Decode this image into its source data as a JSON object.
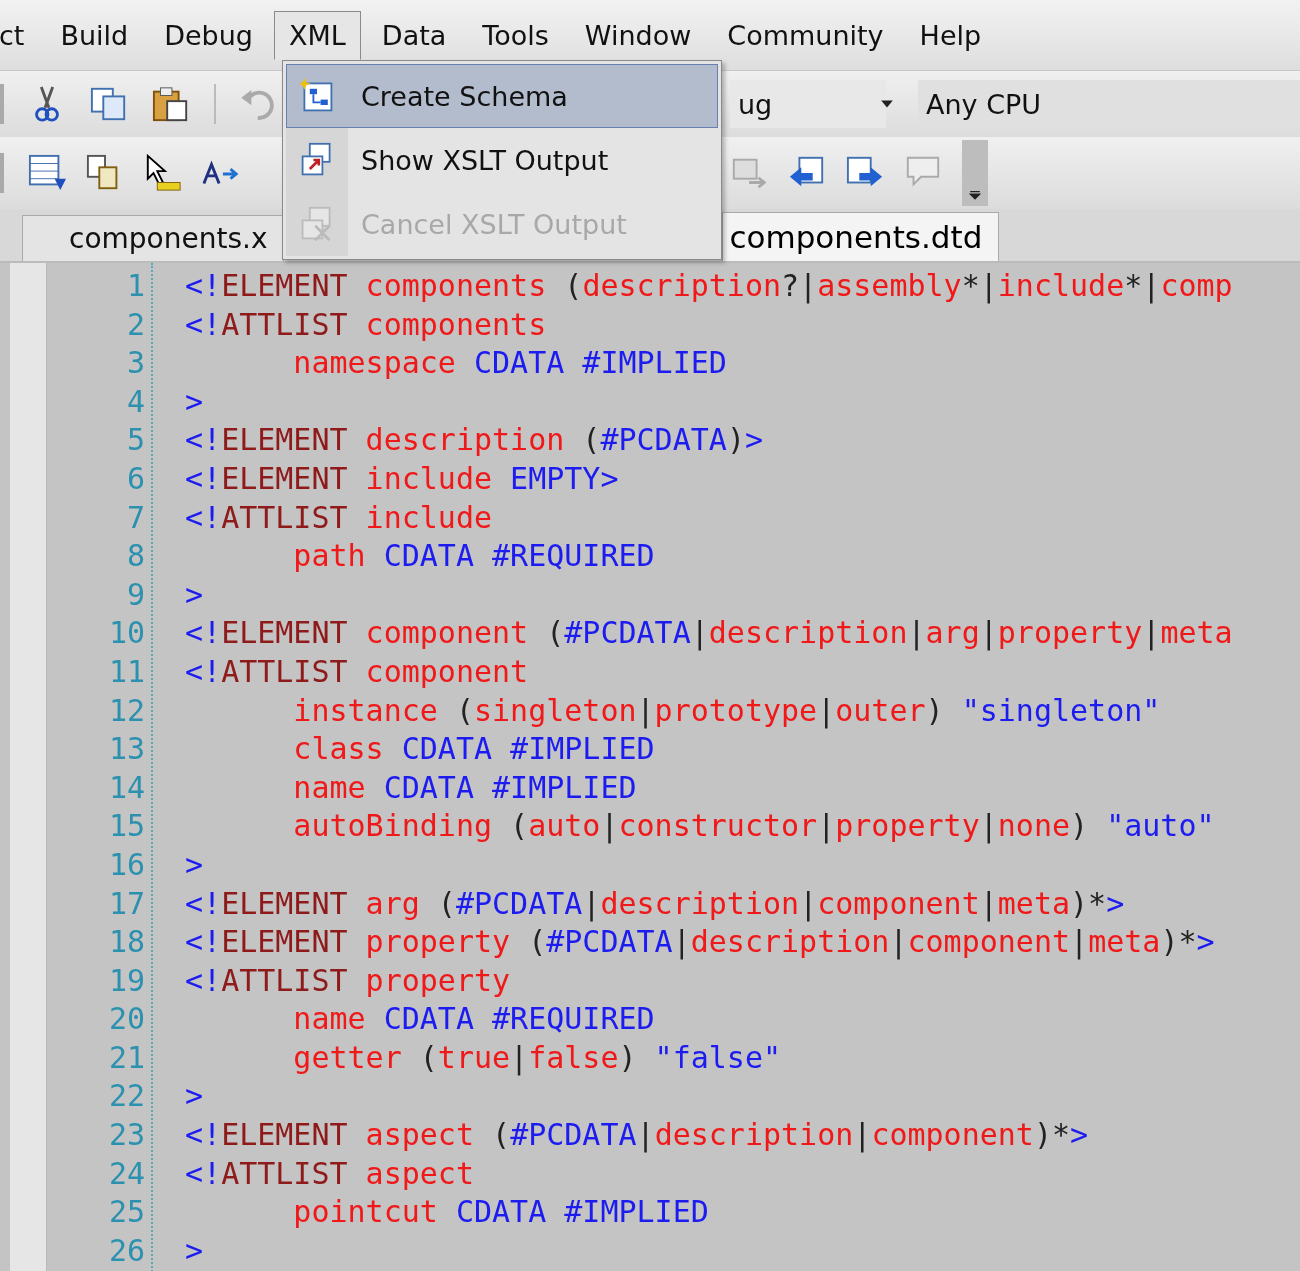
{
  "menu_bar": {
    "items": [
      {
        "label": "ct",
        "selected": false
      },
      {
        "label": "Build",
        "selected": false
      },
      {
        "label": "Debug",
        "selected": false
      },
      {
        "label": "XML",
        "selected": true
      },
      {
        "label": "Data",
        "selected": false
      },
      {
        "label": "Tools",
        "selected": false
      },
      {
        "label": "Window",
        "selected": false
      },
      {
        "label": "Community",
        "selected": false
      },
      {
        "label": "Help",
        "selected": false
      }
    ]
  },
  "toolbar": {
    "configuration": "ug",
    "platform": "Any CPU"
  },
  "tabs": [
    {
      "label": "components.x",
      "selected": false
    },
    {
      "label": "components.dtd",
      "selected": true
    }
  ],
  "xml_menu": {
    "items": [
      {
        "label": "Create Schema",
        "selected": true,
        "disabled": false
      },
      {
        "label": "Show XSLT Output",
        "selected": false,
        "disabled": false
      },
      {
        "label": "Cancel XSLT Output",
        "selected": false,
        "disabled": true
      }
    ]
  },
  "editor": {
    "lines": [
      {
        "number": "1",
        "indented": false,
        "tokens": [
          {
            "kind": "delim",
            "text": "<!"
          },
          {
            "kind": "keyword",
            "text": "ELEMENT"
          },
          {
            "kind": "name",
            "text": " components"
          },
          {
            "kind": "plain",
            "text": " ("
          },
          {
            "kind": "name",
            "text": "description"
          },
          {
            "kind": "plain",
            "text": "?|"
          },
          {
            "kind": "name",
            "text": "assembly"
          },
          {
            "kind": "plain",
            "text": "*|"
          },
          {
            "kind": "name",
            "text": "include"
          },
          {
            "kind": "plain",
            "text": "*|"
          },
          {
            "kind": "name",
            "text": "comp"
          }
        ]
      },
      {
        "number": "2",
        "indented": false,
        "tokens": [
          {
            "kind": "delim",
            "text": "<!"
          },
          {
            "kind": "keyword",
            "text": "ATTLIST"
          },
          {
            "kind": "name",
            "text": " components"
          }
        ]
      },
      {
        "number": "3",
        "indented": true,
        "tokens": [
          {
            "kind": "name",
            "text": "namespace"
          },
          {
            "kind": "value",
            "text": " CDATA #IMPLIED"
          }
        ]
      },
      {
        "number": "4",
        "indented": false,
        "tokens": [
          {
            "kind": "delim",
            "text": ">"
          }
        ]
      },
      {
        "number": "5",
        "indented": false,
        "tokens": [
          {
            "kind": "delim",
            "text": "<!"
          },
          {
            "kind": "keyword",
            "text": "ELEMENT"
          },
          {
            "kind": "name",
            "text": " description"
          },
          {
            "kind": "plain",
            "text": " ("
          },
          {
            "kind": "value",
            "text": "#PCDATA"
          },
          {
            "kind": "plain",
            "text": ")"
          },
          {
            "kind": "delim",
            "text": ">"
          }
        ]
      },
      {
        "number": "6",
        "indented": false,
        "tokens": [
          {
            "kind": "delim",
            "text": "<!"
          },
          {
            "kind": "keyword",
            "text": "ELEMENT"
          },
          {
            "kind": "name",
            "text": " include"
          },
          {
            "kind": "value",
            "text": " EMPTY"
          },
          {
            "kind": "delim",
            "text": ">"
          }
        ]
      },
      {
        "number": "7",
        "indented": false,
        "tokens": [
          {
            "kind": "delim",
            "text": "<!"
          },
          {
            "kind": "keyword",
            "text": "ATTLIST"
          },
          {
            "kind": "name",
            "text": " include"
          }
        ]
      },
      {
        "number": "8",
        "indented": true,
        "tokens": [
          {
            "kind": "name",
            "text": "path"
          },
          {
            "kind": "value",
            "text": " CDATA #REQUIRED"
          }
        ]
      },
      {
        "number": "9",
        "indented": false,
        "tokens": [
          {
            "kind": "delim",
            "text": ">"
          }
        ]
      },
      {
        "number": "10",
        "indented": false,
        "tokens": [
          {
            "kind": "delim",
            "text": "<!"
          },
          {
            "kind": "keyword",
            "text": "ELEMENT"
          },
          {
            "kind": "name",
            "text": " component"
          },
          {
            "kind": "plain",
            "text": " ("
          },
          {
            "kind": "value",
            "text": "#PCDATA"
          },
          {
            "kind": "plain",
            "text": "|"
          },
          {
            "kind": "name",
            "text": "description"
          },
          {
            "kind": "plain",
            "text": "|"
          },
          {
            "kind": "name",
            "text": "arg"
          },
          {
            "kind": "plain",
            "text": "|"
          },
          {
            "kind": "name",
            "text": "property"
          },
          {
            "kind": "plain",
            "text": "|"
          },
          {
            "kind": "name",
            "text": "meta"
          }
        ]
      },
      {
        "number": "11",
        "indented": false,
        "tokens": [
          {
            "kind": "delim",
            "text": "<!"
          },
          {
            "kind": "keyword",
            "text": "ATTLIST"
          },
          {
            "kind": "name",
            "text": " component"
          }
        ]
      },
      {
        "number": "12",
        "indented": true,
        "tokens": [
          {
            "kind": "name",
            "text": "instance"
          },
          {
            "kind": "plain",
            "text": " ("
          },
          {
            "kind": "name",
            "text": "singleton"
          },
          {
            "kind": "plain",
            "text": "|"
          },
          {
            "kind": "name",
            "text": "prototype"
          },
          {
            "kind": "plain",
            "text": "|"
          },
          {
            "kind": "name",
            "text": "outer"
          },
          {
            "kind": "plain",
            "text": ") "
          },
          {
            "kind": "value",
            "text": "\"singleton\""
          }
        ]
      },
      {
        "number": "13",
        "indented": true,
        "tokens": [
          {
            "kind": "name",
            "text": "class"
          },
          {
            "kind": "value",
            "text": " CDATA #IMPLIED"
          }
        ]
      },
      {
        "number": "14",
        "indented": true,
        "tokens": [
          {
            "kind": "name",
            "text": "name"
          },
          {
            "kind": "value",
            "text": " CDATA #IMPLIED"
          }
        ]
      },
      {
        "number": "15",
        "indented": true,
        "tokens": [
          {
            "kind": "name",
            "text": "autoBinding"
          },
          {
            "kind": "plain",
            "text": " ("
          },
          {
            "kind": "name",
            "text": "auto"
          },
          {
            "kind": "plain",
            "text": "|"
          },
          {
            "kind": "name",
            "text": "constructor"
          },
          {
            "kind": "plain",
            "text": "|"
          },
          {
            "kind": "name",
            "text": "property"
          },
          {
            "kind": "plain",
            "text": "|"
          },
          {
            "kind": "name",
            "text": "none"
          },
          {
            "kind": "plain",
            "text": ") "
          },
          {
            "kind": "value",
            "text": "\"auto\""
          }
        ]
      },
      {
        "number": "16",
        "indented": false,
        "tokens": [
          {
            "kind": "delim",
            "text": ">"
          }
        ]
      },
      {
        "number": "17",
        "indented": false,
        "tokens": [
          {
            "kind": "delim",
            "text": "<!"
          },
          {
            "kind": "keyword",
            "text": "ELEMENT"
          },
          {
            "kind": "name",
            "text": " arg"
          },
          {
            "kind": "plain",
            "text": " ("
          },
          {
            "kind": "value",
            "text": "#PCDATA"
          },
          {
            "kind": "plain",
            "text": "|"
          },
          {
            "kind": "name",
            "text": "description"
          },
          {
            "kind": "plain",
            "text": "|"
          },
          {
            "kind": "name",
            "text": "component"
          },
          {
            "kind": "plain",
            "text": "|"
          },
          {
            "kind": "name",
            "text": "meta"
          },
          {
            "kind": "plain",
            "text": ")*"
          },
          {
            "kind": "delim",
            "text": ">"
          }
        ]
      },
      {
        "number": "18",
        "indented": false,
        "tokens": [
          {
            "kind": "delim",
            "text": "<!"
          },
          {
            "kind": "keyword",
            "text": "ELEMENT"
          },
          {
            "kind": "name",
            "text": " property"
          },
          {
            "kind": "plain",
            "text": " ("
          },
          {
            "kind": "value",
            "text": "#PCDATA"
          },
          {
            "kind": "plain",
            "text": "|"
          },
          {
            "kind": "name",
            "text": "description"
          },
          {
            "kind": "plain",
            "text": "|"
          },
          {
            "kind": "name",
            "text": "component"
          },
          {
            "kind": "plain",
            "text": "|"
          },
          {
            "kind": "name",
            "text": "meta"
          },
          {
            "kind": "plain",
            "text": ")*"
          },
          {
            "kind": "delim",
            "text": ">"
          }
        ]
      },
      {
        "number": "19",
        "indented": false,
        "tokens": [
          {
            "kind": "delim",
            "text": "<!"
          },
          {
            "kind": "keyword",
            "text": "ATTLIST"
          },
          {
            "kind": "name",
            "text": " property"
          }
        ]
      },
      {
        "number": "20",
        "indented": true,
        "tokens": [
          {
            "kind": "name",
            "text": "name"
          },
          {
            "kind": "value",
            "text": " CDATA #REQUIRED"
          }
        ]
      },
      {
        "number": "21",
        "indented": true,
        "tokens": [
          {
            "kind": "name",
            "text": "getter"
          },
          {
            "kind": "plain",
            "text": " ("
          },
          {
            "kind": "name",
            "text": "true"
          },
          {
            "kind": "plain",
            "text": "|"
          },
          {
            "kind": "name",
            "text": "false"
          },
          {
            "kind": "plain",
            "text": ") "
          },
          {
            "kind": "value",
            "text": "\"false\""
          }
        ]
      },
      {
        "number": "22",
        "indented": false,
        "tokens": [
          {
            "kind": "delim",
            "text": ">"
          }
        ]
      },
      {
        "number": "23",
        "indented": false,
        "tokens": [
          {
            "kind": "delim",
            "text": "<!"
          },
          {
            "kind": "keyword",
            "text": "ELEMENT"
          },
          {
            "kind": "name",
            "text": " aspect"
          },
          {
            "kind": "plain",
            "text": " ("
          },
          {
            "kind": "value",
            "text": "#PCDATA"
          },
          {
            "kind": "plain",
            "text": "|"
          },
          {
            "kind": "name",
            "text": "description"
          },
          {
            "kind": "plain",
            "text": "|"
          },
          {
            "kind": "name",
            "text": "component"
          },
          {
            "kind": "plain",
            "text": ")*"
          },
          {
            "kind": "delim",
            "text": ">"
          }
        ]
      },
      {
        "number": "24",
        "indented": false,
        "tokens": [
          {
            "kind": "delim",
            "text": "<!"
          },
          {
            "kind": "keyword",
            "text": "ATTLIST"
          },
          {
            "kind": "name",
            "text": " aspect"
          }
        ]
      },
      {
        "number": "25",
        "indented": true,
        "tokens": [
          {
            "kind": "name",
            "text": "pointcut"
          },
          {
            "kind": "value",
            "text": " CDATA #IMPLIED"
          }
        ]
      },
      {
        "number": "26",
        "indented": false,
        "tokens": [
          {
            "kind": "delim",
            "text": ">"
          }
        ]
      }
    ]
  }
}
